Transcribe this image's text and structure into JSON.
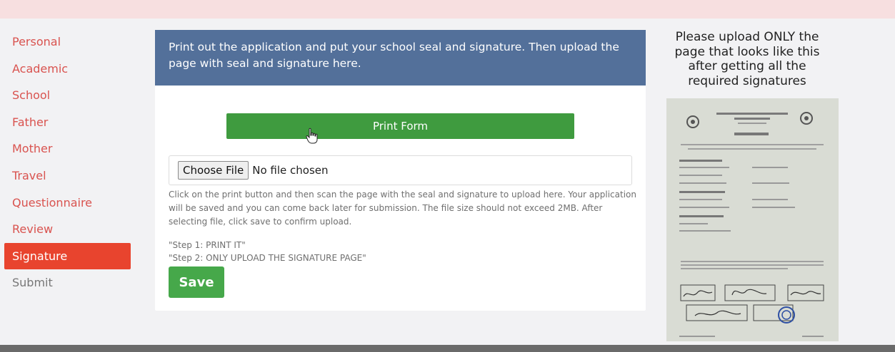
{
  "sidebar": {
    "items": [
      {
        "label": "Personal"
      },
      {
        "label": "Academic"
      },
      {
        "label": "School"
      },
      {
        "label": "Father"
      },
      {
        "label": "Mother"
      },
      {
        "label": "Travel"
      },
      {
        "label": "Questionnaire"
      },
      {
        "label": "Review"
      },
      {
        "label": "Signature",
        "active": true
      },
      {
        "label": "Submit"
      }
    ]
  },
  "card": {
    "header": "Print out the application and put your school seal and signature. Then upload the page with seal and signature here.",
    "print_button": "Print Form",
    "choose_file_button": "Choose File",
    "file_status": "No file chosen",
    "help_text": "Click on the print button and then scan the page with the seal and signature to upload here. Your application will be saved and you can come back later for submission. The file size should not exceed 2MB. After selecting file, click save to confirm upload.",
    "step1": "\"Step 1: PRINT IT\"",
    "step2": "\"Step 2: ONLY UPLOAD THE SIGNATURE PAGE\"",
    "save_button": "Save"
  },
  "instruction": "Please upload ONLY the page that looks like this after getting all the required signatures",
  "colors": {
    "active_tab": "#e8442e",
    "header_bg": "#53709a",
    "print_button": "#3f9b3f",
    "save_button": "#46a84a",
    "sidebar_text": "#d9534f"
  }
}
